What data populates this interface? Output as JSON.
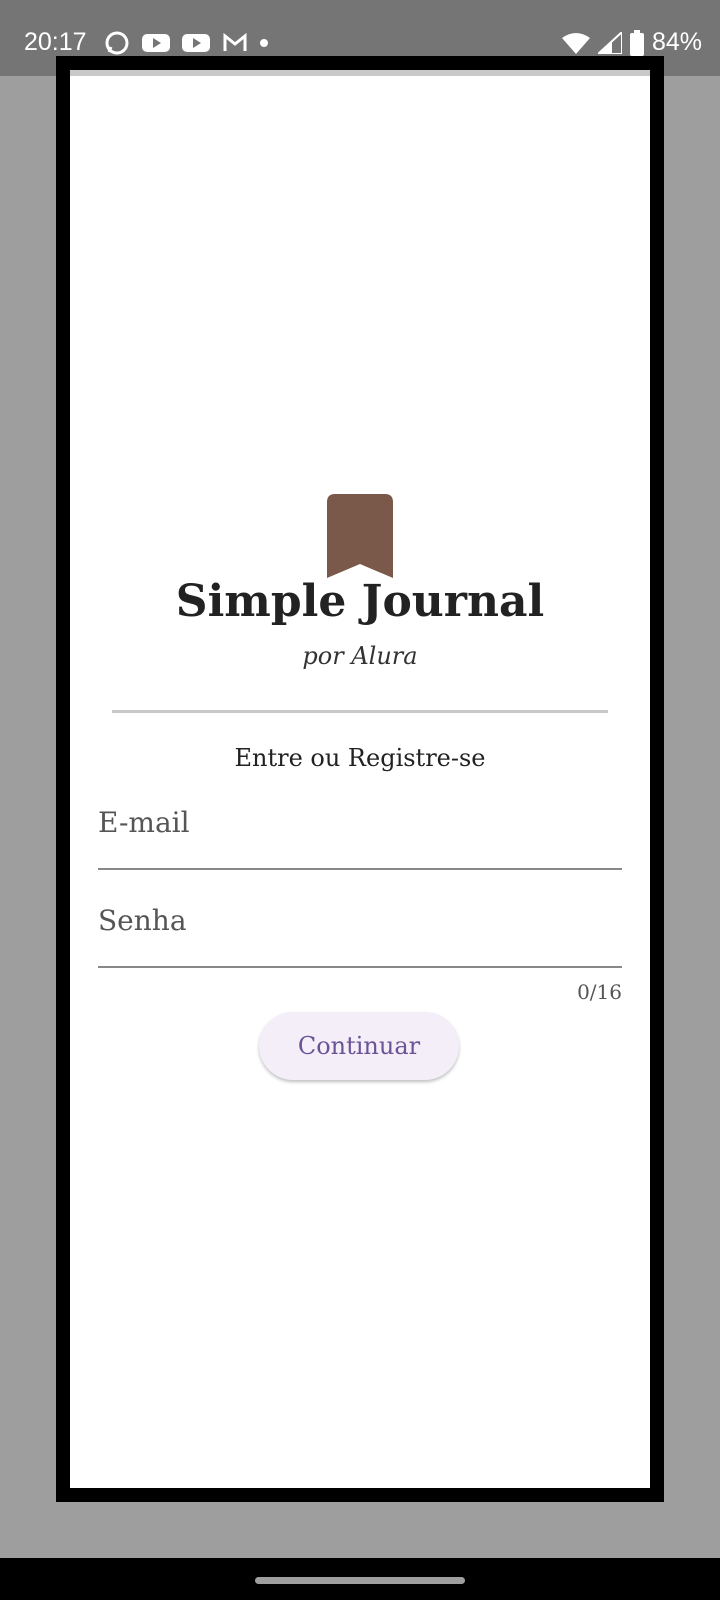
{
  "status_bar": {
    "time": "20:17",
    "battery": "84%",
    "left_icons": [
      "whatsapp-icon",
      "youtube-icon",
      "youtube-icon",
      "gmail-icon",
      "notification-dot-icon"
    ],
    "right_icons": [
      "wifi-icon",
      "signal-icon",
      "battery-icon"
    ]
  },
  "app": {
    "logo_icon": "bookmark-icon",
    "logo_color": "#7a584a",
    "title": "Simple Journal",
    "subtitle": "por Alura",
    "prompt": "Entre ou Registre-se"
  },
  "form": {
    "email_label": "E-mail",
    "password_label": "Senha",
    "password_counter": "0/16",
    "continue_label": "Continuar"
  },
  "colors": {
    "button_bg": "#f3eef8",
    "button_text": "#6a5496"
  }
}
